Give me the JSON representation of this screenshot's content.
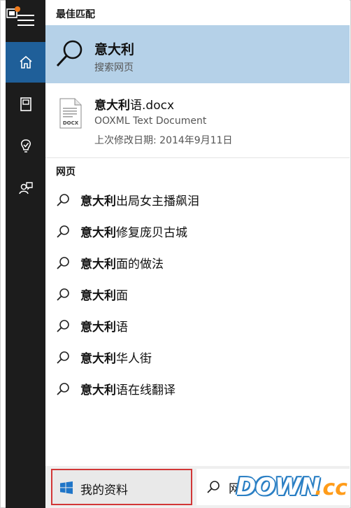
{
  "rail": {
    "items": [
      {
        "name": "home-icon",
        "active": true
      },
      {
        "name": "notebook-icon",
        "active": false
      },
      {
        "name": "lightbulb-icon",
        "active": false
      },
      {
        "name": "feedback-icon",
        "active": false
      }
    ]
  },
  "sections": {
    "best_match": "最佳匹配",
    "web": "网页"
  },
  "best_match": {
    "title": "意大利",
    "subtitle": "搜索网页"
  },
  "document": {
    "title_bold": "意大利",
    "title_rest": "语.docx",
    "type": "OOXML Text Document",
    "modified": "上次修改日期: 2014年9月11日",
    "icon_label": "DOCX"
  },
  "web_results": [
    {
      "bold": "意大利",
      "rest": "出局女主播飙泪"
    },
    {
      "bold": "意大利",
      "rest": "修复庞贝古城"
    },
    {
      "bold": "意大利",
      "rest": "面的做法"
    },
    {
      "bold": "意大利",
      "rest": "面"
    },
    {
      "bold": "意大利",
      "rest": "语"
    },
    {
      "bold": "意大利",
      "rest": "华人街"
    },
    {
      "bold": "意大利",
      "rest": "语在线翻译"
    }
  ],
  "bottom": {
    "my_stuff_label": "我的资料",
    "search_value": "网"
  },
  "watermark": {
    "brand": "DOWN",
    "suffix": ".cc"
  },
  "colors": {
    "rail_bg": "#1c1c1c",
    "rail_active": "#1f5f99",
    "best_match_bg": "#b5d1e8",
    "highlight_border": "#d23737",
    "watermark_blue": "#2a7fc4",
    "watermark_orange": "#ff9c1a"
  }
}
